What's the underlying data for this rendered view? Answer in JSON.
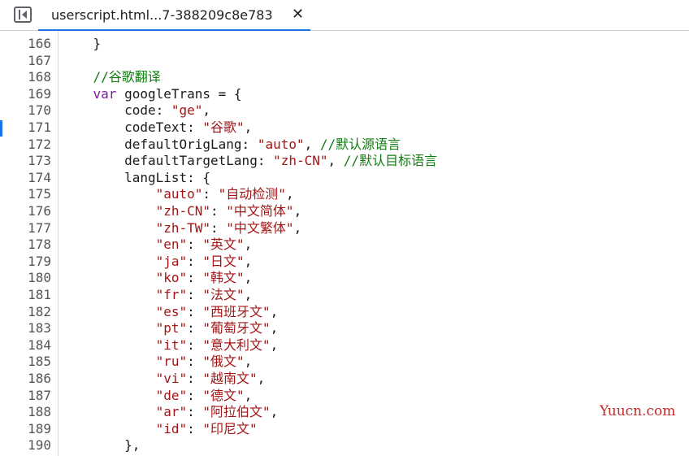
{
  "tab": {
    "label": "userscript.html...7-388209c8e783",
    "close": "✕"
  },
  "watermark": "Yuucn.com",
  "colors": {
    "keyword": "#7b1fa2",
    "string": "#a31515",
    "comment": "#107c10",
    "accent": "#1a73e8"
  },
  "lines": [
    {
      "n": "166",
      "segs": [
        [
          "p",
          "    }"
        ]
      ]
    },
    {
      "n": "167",
      "segs": []
    },
    {
      "n": "168",
      "segs": [
        [
          "p",
          "    "
        ],
        [
          "cm",
          "//谷歌翻译"
        ]
      ]
    },
    {
      "n": "169",
      "segs": [
        [
          "p",
          "    "
        ],
        [
          "kw",
          "var"
        ],
        [
          "p",
          " googleTrans = {"
        ]
      ]
    },
    {
      "n": "170",
      "segs": [
        [
          "p",
          "        code: "
        ],
        [
          "str",
          "\"ge\""
        ],
        [
          "p",
          ","
        ]
      ]
    },
    {
      "n": "171",
      "segs": [
        [
          "p",
          "        codeText: "
        ],
        [
          "str",
          "\"谷歌\""
        ],
        [
          "p",
          ","
        ]
      ]
    },
    {
      "n": "172",
      "segs": [
        [
          "p",
          "        defaultOrigLang: "
        ],
        [
          "str",
          "\"auto\""
        ],
        [
          "p",
          ", "
        ],
        [
          "cm",
          "//默认源语言"
        ]
      ]
    },
    {
      "n": "173",
      "segs": [
        [
          "p",
          "        defaultTargetLang: "
        ],
        [
          "str",
          "\"zh-CN\""
        ],
        [
          "p",
          ", "
        ],
        [
          "cm",
          "//默认目标语言"
        ]
      ]
    },
    {
      "n": "174",
      "segs": [
        [
          "p",
          "        langList: {"
        ]
      ]
    },
    {
      "n": "175",
      "segs": [
        [
          "p",
          "            "
        ],
        [
          "str",
          "\"auto\""
        ],
        [
          "p",
          ": "
        ],
        [
          "str",
          "\"自动检测\""
        ],
        [
          "p",
          ","
        ]
      ]
    },
    {
      "n": "176",
      "segs": [
        [
          "p",
          "            "
        ],
        [
          "str",
          "\"zh-CN\""
        ],
        [
          "p",
          ": "
        ],
        [
          "str",
          "\"中文简体\""
        ],
        [
          "p",
          ","
        ]
      ]
    },
    {
      "n": "177",
      "segs": [
        [
          "p",
          "            "
        ],
        [
          "str",
          "\"zh-TW\""
        ],
        [
          "p",
          ": "
        ],
        [
          "str",
          "\"中文繁体\""
        ],
        [
          "p",
          ","
        ]
      ]
    },
    {
      "n": "178",
      "segs": [
        [
          "p",
          "            "
        ],
        [
          "str",
          "\"en\""
        ],
        [
          "p",
          ": "
        ],
        [
          "str",
          "\"英文\""
        ],
        [
          "p",
          ","
        ]
      ]
    },
    {
      "n": "179",
      "segs": [
        [
          "p",
          "            "
        ],
        [
          "str",
          "\"ja\""
        ],
        [
          "p",
          ": "
        ],
        [
          "str",
          "\"日文\""
        ],
        [
          "p",
          ","
        ]
      ]
    },
    {
      "n": "180",
      "segs": [
        [
          "p",
          "            "
        ],
        [
          "str",
          "\"ko\""
        ],
        [
          "p",
          ": "
        ],
        [
          "str",
          "\"韩文\""
        ],
        [
          "p",
          ","
        ]
      ]
    },
    {
      "n": "181",
      "segs": [
        [
          "p",
          "            "
        ],
        [
          "str",
          "\"fr\""
        ],
        [
          "p",
          ": "
        ],
        [
          "str",
          "\"法文\""
        ],
        [
          "p",
          ","
        ]
      ]
    },
    {
      "n": "182",
      "segs": [
        [
          "p",
          "            "
        ],
        [
          "str",
          "\"es\""
        ],
        [
          "p",
          ": "
        ],
        [
          "str",
          "\"西班牙文\""
        ],
        [
          "p",
          ","
        ]
      ]
    },
    {
      "n": "183",
      "segs": [
        [
          "p",
          "            "
        ],
        [
          "str",
          "\"pt\""
        ],
        [
          "p",
          ": "
        ],
        [
          "str",
          "\"葡萄牙文\""
        ],
        [
          "p",
          ","
        ]
      ]
    },
    {
      "n": "184",
      "segs": [
        [
          "p",
          "            "
        ],
        [
          "str",
          "\"it\""
        ],
        [
          "p",
          ": "
        ],
        [
          "str",
          "\"意大利文\""
        ],
        [
          "p",
          ","
        ]
      ]
    },
    {
      "n": "185",
      "segs": [
        [
          "p",
          "            "
        ],
        [
          "str",
          "\"ru\""
        ],
        [
          "p",
          ": "
        ],
        [
          "str",
          "\"俄文\""
        ],
        [
          "p",
          ","
        ]
      ]
    },
    {
      "n": "186",
      "segs": [
        [
          "p",
          "            "
        ],
        [
          "str",
          "\"vi\""
        ],
        [
          "p",
          ": "
        ],
        [
          "str",
          "\"越南文\""
        ],
        [
          "p",
          ","
        ]
      ]
    },
    {
      "n": "187",
      "segs": [
        [
          "p",
          "            "
        ],
        [
          "str",
          "\"de\""
        ],
        [
          "p",
          ": "
        ],
        [
          "str",
          "\"德文\""
        ],
        [
          "p",
          ","
        ]
      ]
    },
    {
      "n": "188",
      "segs": [
        [
          "p",
          "            "
        ],
        [
          "str",
          "\"ar\""
        ],
        [
          "p",
          ": "
        ],
        [
          "str",
          "\"阿拉伯文\""
        ],
        [
          "p",
          ","
        ]
      ]
    },
    {
      "n": "189",
      "segs": [
        [
          "p",
          "            "
        ],
        [
          "str",
          "\"id\""
        ],
        [
          "p",
          ": "
        ],
        [
          "str",
          "\"印尼文\""
        ]
      ]
    },
    {
      "n": "190",
      "segs": [
        [
          "p",
          "        },"
        ]
      ]
    }
  ]
}
